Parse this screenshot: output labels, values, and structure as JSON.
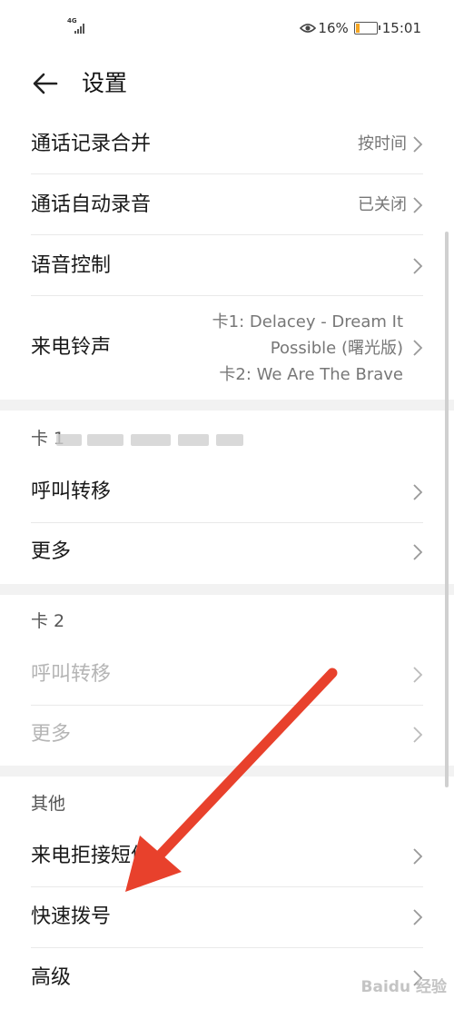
{
  "status_bar": {
    "network": "4G",
    "battery_percent": "16%",
    "battery_level": 0.16,
    "time": "15:01",
    "icons": [
      "signal-icon",
      "eye-icon",
      "battery-icon"
    ],
    "battery_color": "#f5a623"
  },
  "header": {
    "title": "设置",
    "back_icon": "arrow-left-icon"
  },
  "rows": {
    "merge_call_log": {
      "label": "通话记录合并",
      "value": "按时间"
    },
    "auto_record": {
      "label": "通话自动录音",
      "value": "已关闭"
    },
    "voice_control": {
      "label": "语音控制"
    },
    "ringtone": {
      "label": "来电铃声",
      "value_line1": "卡1: Delacey - Dream It",
      "value_line2": "Possible (曙光版)",
      "value_line3": "卡2: We Are The Brave"
    }
  },
  "sections": {
    "card1": {
      "title": "卡 1",
      "items": [
        {
          "label": "呼叫转移"
        },
        {
          "label": "更多"
        }
      ]
    },
    "card2": {
      "title": "卡 2",
      "items": [
        {
          "label": "呼叫转移",
          "disabled": true
        },
        {
          "label": "更多",
          "disabled": true
        }
      ]
    },
    "other": {
      "title": "其他",
      "items": [
        {
          "label": "来电拒接短信"
        },
        {
          "label": "快速拨号"
        },
        {
          "label": "高级"
        }
      ]
    }
  },
  "annotation": {
    "arrow_color": "#e8412c"
  },
  "watermark": "Baidu 经验",
  "colors": {
    "section_gap": "#f2f2f2",
    "divider": "#e9e9e9",
    "disabled_text": "#b5b5b5",
    "secondary_text": "#777777"
  }
}
